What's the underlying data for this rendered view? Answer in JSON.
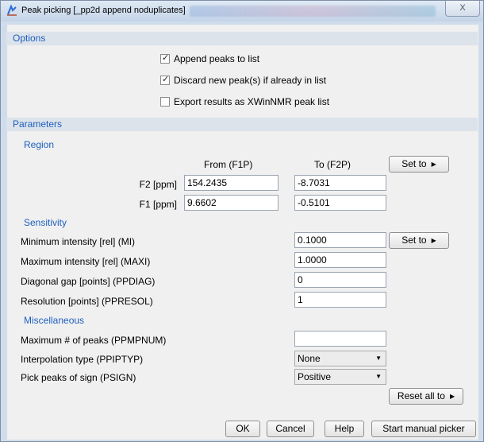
{
  "window": {
    "title": "Peak picking [_pp2d append noduplicates]",
    "close_label": "X"
  },
  "options": {
    "header": "Options",
    "checkboxes": [
      {
        "label": "Append peaks to list",
        "checked": true
      },
      {
        "label": "Discard new peak(s) if already in list",
        "checked": true
      },
      {
        "label": "Export results as XWinNMR peak list",
        "checked": false
      }
    ]
  },
  "parameters": {
    "header": "Parameters",
    "region": {
      "header": "Region",
      "from_header": "From (F1P)",
      "to_header": "To (F2P)",
      "set_to_label": "Set to",
      "rows": [
        {
          "label": "F2 [ppm]",
          "from": "154.2435",
          "to": "-8.7031"
        },
        {
          "label": "F1 [ppm]",
          "from": "9.6602",
          "to": "-0.5101"
        }
      ]
    },
    "sensitivity": {
      "header": "Sensitivity",
      "set_to_label": "Set to",
      "rows": [
        {
          "label": "Minimum intensity [rel] (MI)",
          "value": "0.1000"
        },
        {
          "label": "Maximum intensity [rel] (MAXI)",
          "value": "1.0000"
        },
        {
          "label": "Diagonal gap [points] (PPDIAG)",
          "value": "0"
        },
        {
          "label": "Resolution [points] (PPRESOL)",
          "value": "1"
        }
      ]
    },
    "miscellaneous": {
      "header": "Miscellaneous",
      "max_peaks_label": "Maximum # of peaks (PPMPNUM)",
      "max_peaks_value": "",
      "interp_label": "Interpolation type (PPIPTYP)",
      "interp_value": "None",
      "sign_label": "Pick peaks of sign (PSIGN)",
      "sign_value": "Positive",
      "reset_label": "Reset all to"
    }
  },
  "buttons": {
    "ok": "OK",
    "cancel": "Cancel",
    "help": "Help",
    "manual": "Start manual picker"
  },
  "colors": {
    "section_header_text": "#1d5fbf",
    "section_header_bg": "#dde3eb",
    "window_frame": "#cfdcec"
  }
}
